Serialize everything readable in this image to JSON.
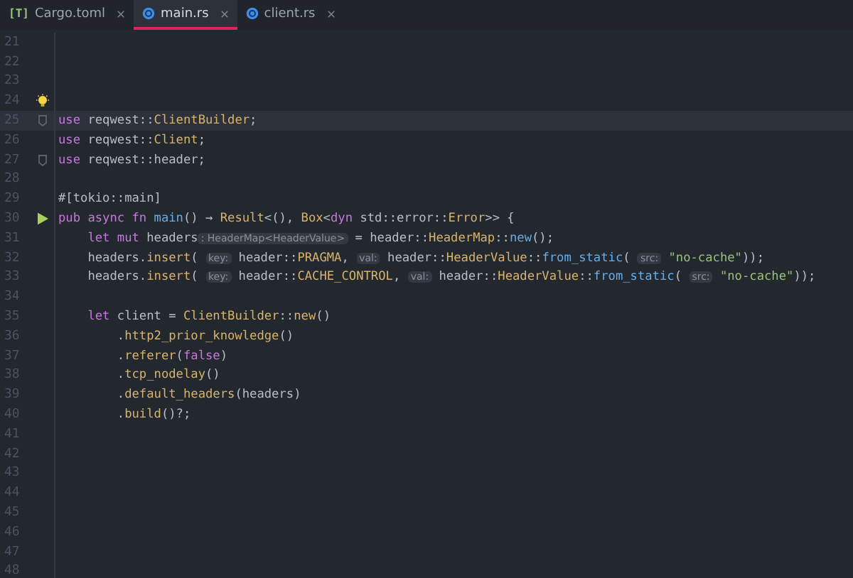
{
  "tabs": [
    {
      "label": "Cargo.toml",
      "icon_text": "[T]",
      "selected": false
    },
    {
      "label": "main.rs",
      "selected": true
    },
    {
      "label": "client.rs",
      "selected": false
    }
  ],
  "lines": [
    {
      "number": "21"
    },
    {
      "number": "22"
    },
    {
      "number": "23"
    },
    {
      "number": "24",
      "lightbulb": true
    },
    {
      "number": "25",
      "fold_marker": true,
      "current": true,
      "tokens": [
        {
          "kind": "kw",
          "text": "use "
        },
        {
          "kind": "plain",
          "text": "reqwest::"
        },
        {
          "kind": "type",
          "text": "ClientBuilder"
        },
        {
          "kind": "plain",
          "text": ";"
        }
      ]
    },
    {
      "number": "26",
      "tokens": [
        {
          "kind": "kw",
          "text": "use "
        },
        {
          "kind": "plain",
          "text": "reqwest::"
        },
        {
          "kind": "type",
          "text": "Client"
        },
        {
          "kind": "plain",
          "text": ";"
        }
      ]
    },
    {
      "number": "27",
      "fold_marker": true,
      "tokens": [
        {
          "kind": "kw",
          "text": "use "
        },
        {
          "kind": "plain",
          "text": "reqwest::header;"
        }
      ]
    },
    {
      "number": "28"
    },
    {
      "number": "29",
      "tokens": [
        {
          "kind": "plain",
          "text": "#[tokio::main]"
        }
      ]
    },
    {
      "number": "30",
      "run_button": true,
      "tokens": [
        {
          "kind": "kw",
          "text": "pub async fn "
        },
        {
          "kind": "fn",
          "text": "main"
        },
        {
          "kind": "plain",
          "text": "() → "
        },
        {
          "kind": "type",
          "text": "Result"
        },
        {
          "kind": "plain",
          "text": "<(), "
        },
        {
          "kind": "type",
          "text": "Box"
        },
        {
          "kind": "plain",
          "text": "<"
        },
        {
          "kind": "kw",
          "text": "dyn "
        },
        {
          "kind": "plain",
          "text": "std::error::"
        },
        {
          "kind": "type",
          "text": "Error"
        },
        {
          "kind": "plain",
          "text": ">> {"
        }
      ]
    },
    {
      "number": "31",
      "tokens": [
        {
          "kind": "kw",
          "text": "    let mut "
        },
        {
          "kind": "plain",
          "text": "headers"
        },
        {
          "kind": "hint",
          "text": ": HeaderMap<HeaderValue>"
        },
        {
          "kind": "plain",
          "text": " = header::"
        },
        {
          "kind": "type",
          "text": "HeaderMap"
        },
        {
          "kind": "plain",
          "text": "::"
        },
        {
          "kind": "fn",
          "text": "new"
        },
        {
          "kind": "plain",
          "text": "();"
        }
      ]
    },
    {
      "number": "32",
      "tokens": [
        {
          "kind": "plain",
          "text": "    headers."
        },
        {
          "kind": "method",
          "text": "insert"
        },
        {
          "kind": "plain",
          "text": "( "
        },
        {
          "kind": "hint",
          "text": "key:"
        },
        {
          "kind": "plain",
          "text": " header::"
        },
        {
          "kind": "type",
          "text": "PRAGMA"
        },
        {
          "kind": "plain",
          "text": ", "
        },
        {
          "kind": "hint",
          "text": "val:"
        },
        {
          "kind": "plain",
          "text": " header::"
        },
        {
          "kind": "type",
          "text": "HeaderValue"
        },
        {
          "kind": "plain",
          "text": "::"
        },
        {
          "kind": "fn",
          "text": "from_static"
        },
        {
          "kind": "plain",
          "text": "( "
        },
        {
          "kind": "hint",
          "text": "src:"
        },
        {
          "kind": "str",
          "text": " \"no-cache\""
        },
        {
          "kind": "plain",
          "text": "));"
        }
      ]
    },
    {
      "number": "33",
      "tokens": [
        {
          "kind": "plain",
          "text": "    headers."
        },
        {
          "kind": "method",
          "text": "insert"
        },
        {
          "kind": "plain",
          "text": "( "
        },
        {
          "kind": "hint",
          "text": "key:"
        },
        {
          "kind": "plain",
          "text": " header::"
        },
        {
          "kind": "type",
          "text": "CACHE_CONTROL"
        },
        {
          "kind": "plain",
          "text": ", "
        },
        {
          "kind": "hint",
          "text": "val:"
        },
        {
          "kind": "plain",
          "text": " header::"
        },
        {
          "kind": "type",
          "text": "HeaderValue"
        },
        {
          "kind": "plain",
          "text": "::"
        },
        {
          "kind": "fn",
          "text": "from_static"
        },
        {
          "kind": "plain",
          "text": "( "
        },
        {
          "kind": "hint",
          "text": "src:"
        },
        {
          "kind": "str",
          "text": " \"no-cache\""
        },
        {
          "kind": "plain",
          "text": "));"
        }
      ]
    },
    {
      "number": "34"
    },
    {
      "number": "35",
      "tokens": [
        {
          "kind": "kw",
          "text": "    let "
        },
        {
          "kind": "plain",
          "text": "client = "
        },
        {
          "kind": "type",
          "text": "ClientBuilder"
        },
        {
          "kind": "plain",
          "text": "::"
        },
        {
          "kind": "method",
          "text": "new"
        },
        {
          "kind": "plain",
          "text": "()"
        }
      ]
    },
    {
      "number": "36",
      "tokens": [
        {
          "kind": "plain",
          "text": "        ."
        },
        {
          "kind": "method",
          "text": "http2_prior_knowledge"
        },
        {
          "kind": "plain",
          "text": "()"
        }
      ]
    },
    {
      "number": "37",
      "tokens": [
        {
          "kind": "plain",
          "text": "        ."
        },
        {
          "kind": "method",
          "text": "referer"
        },
        {
          "kind": "plain",
          "text": "("
        },
        {
          "kind": "kw",
          "text": "false"
        },
        {
          "kind": "plain",
          "text": ")"
        }
      ]
    },
    {
      "number": "38",
      "tokens": [
        {
          "kind": "plain",
          "text": "        ."
        },
        {
          "kind": "method",
          "text": "tcp_nodelay"
        },
        {
          "kind": "plain",
          "text": "()"
        }
      ]
    },
    {
      "number": "39",
      "tokens": [
        {
          "kind": "plain",
          "text": "        ."
        },
        {
          "kind": "method",
          "text": "default_headers"
        },
        {
          "kind": "plain",
          "text": "(headers)"
        }
      ]
    },
    {
      "number": "40",
      "tokens": [
        {
          "kind": "plain",
          "text": "        ."
        },
        {
          "kind": "method",
          "text": "build"
        },
        {
          "kind": "plain",
          "text": "()?;"
        }
      ]
    },
    {
      "number": "41"
    },
    {
      "number": "42"
    },
    {
      "number": "43"
    },
    {
      "number": "44"
    },
    {
      "number": "45"
    },
    {
      "number": "46"
    },
    {
      "number": "47"
    },
    {
      "number": "48"
    }
  ]
}
